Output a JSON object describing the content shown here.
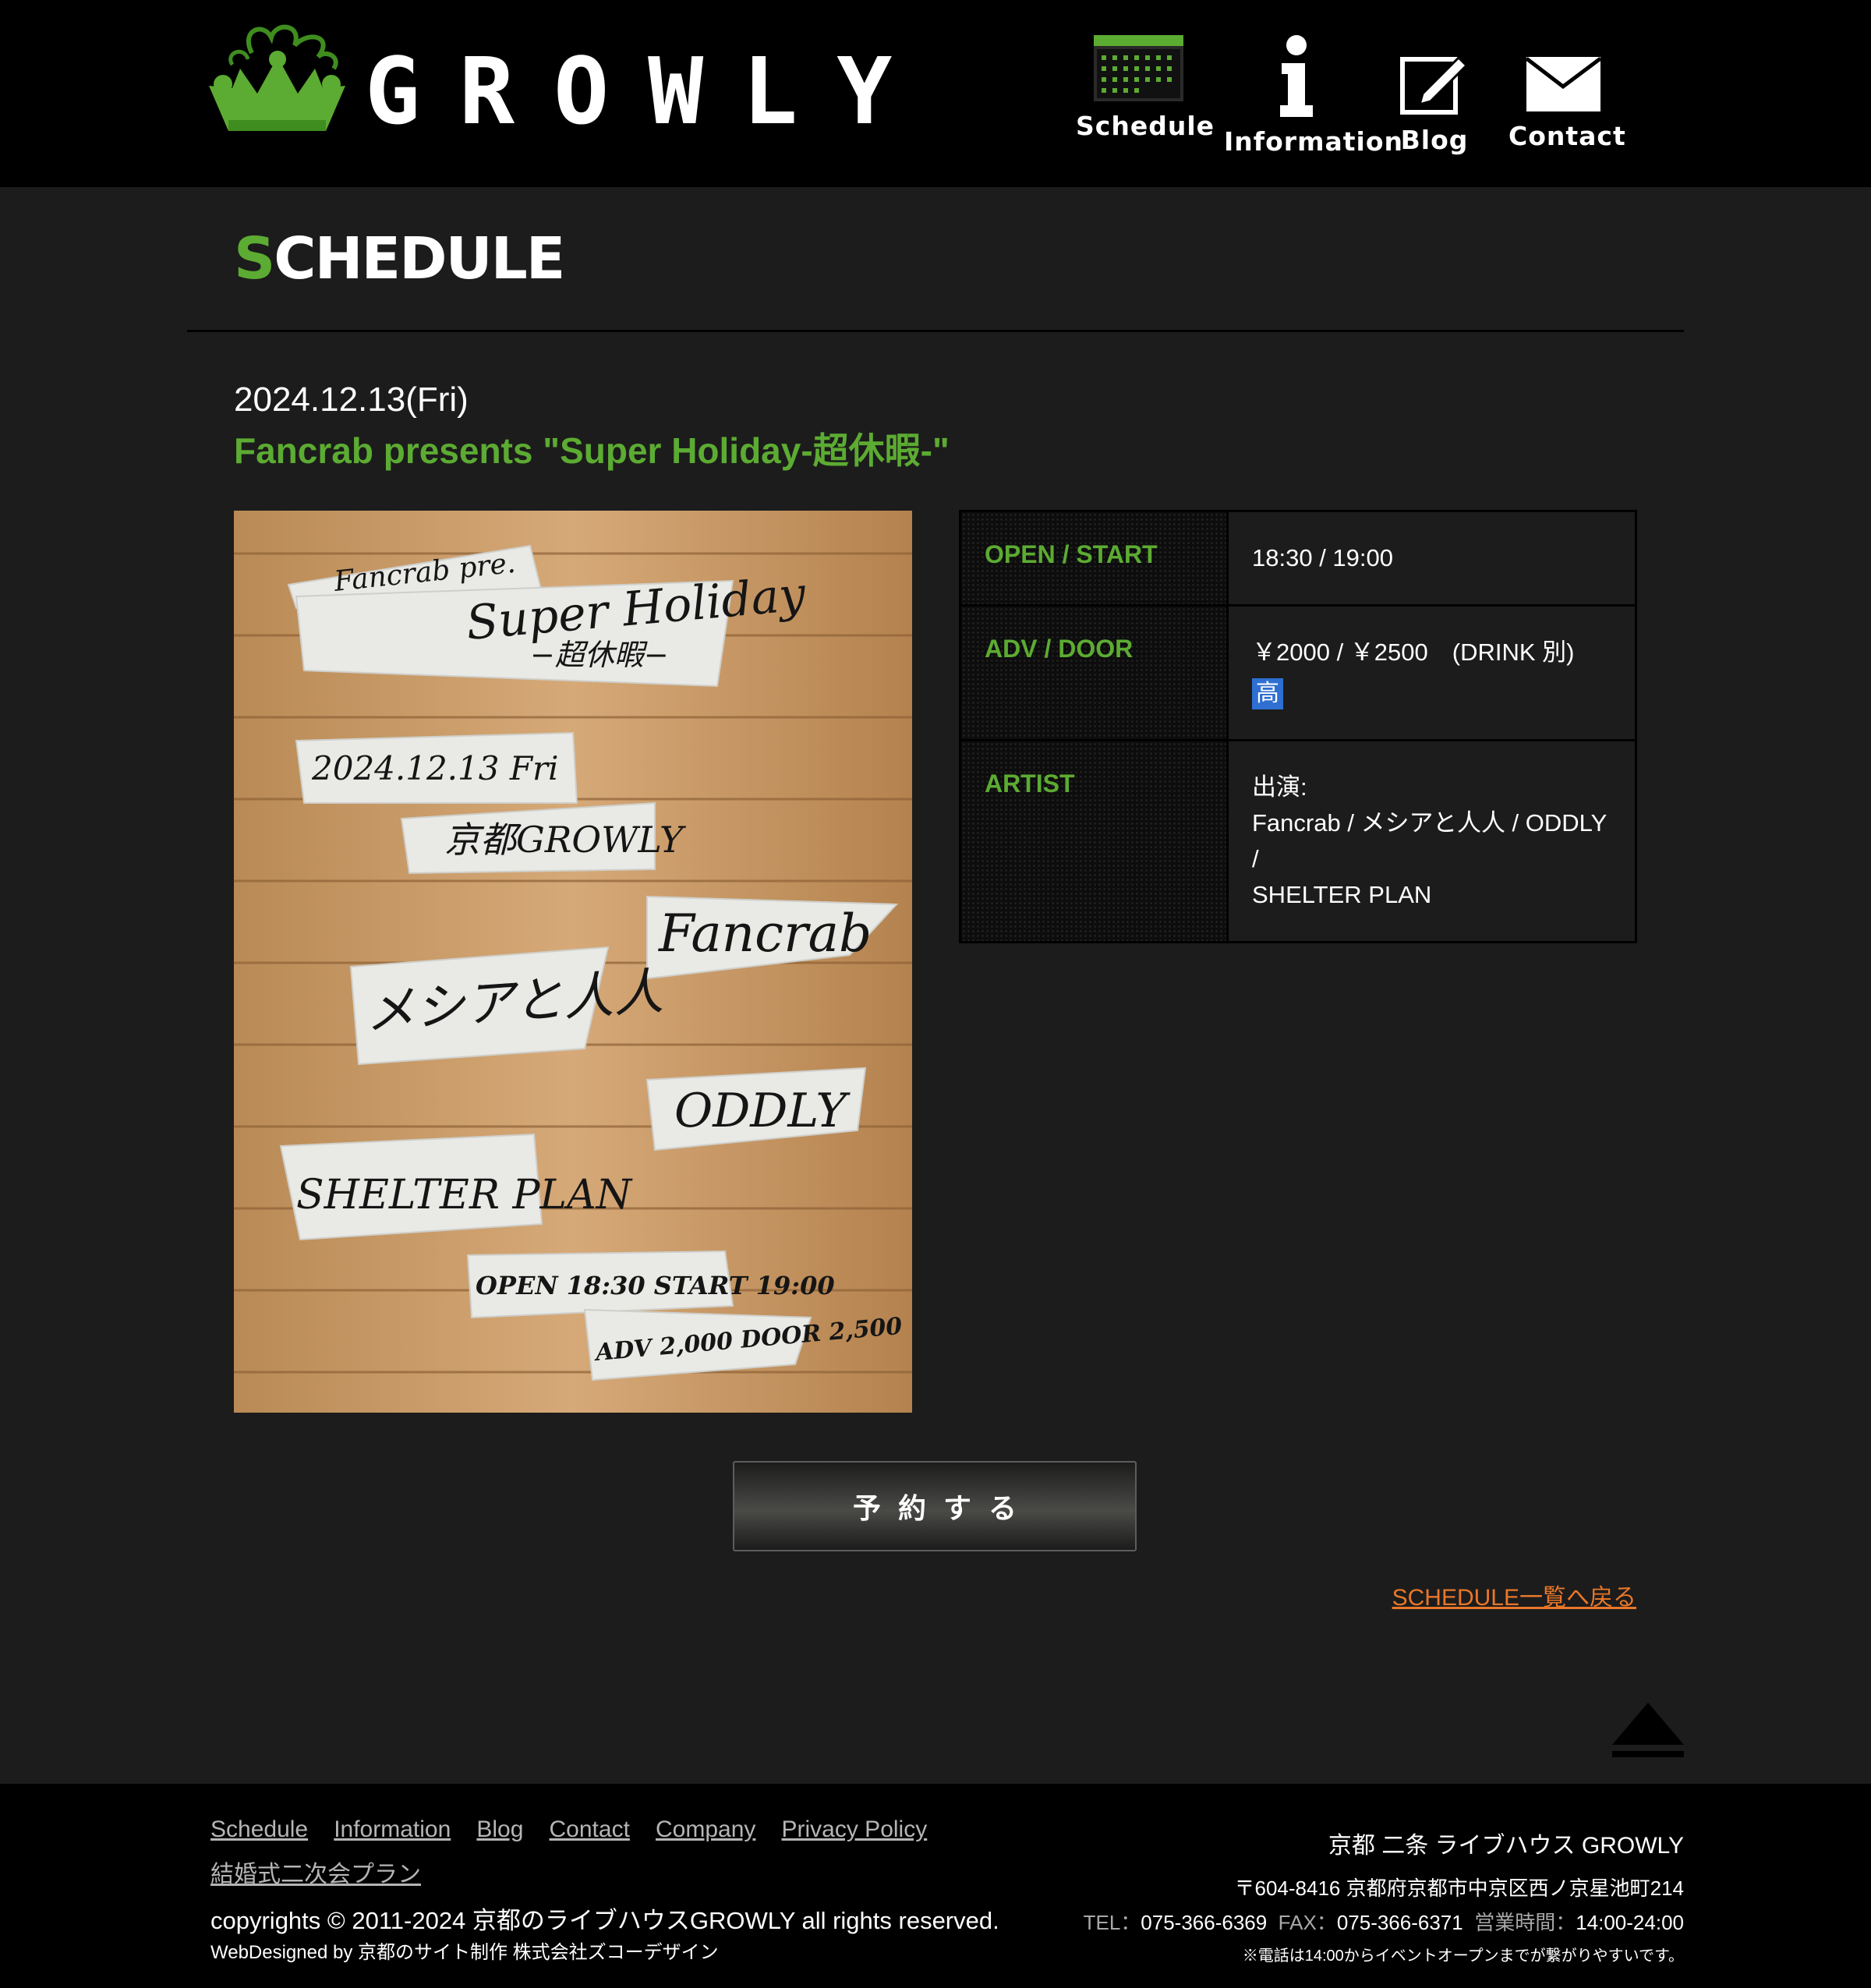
{
  "header": {
    "logo_text": "GROWLY",
    "nav": [
      {
        "label": "Schedule",
        "icon": "calendar-icon"
      },
      {
        "label": "Information",
        "icon": "info-icon"
      },
      {
        "label": "Blog",
        "icon": "pencil-note-icon"
      },
      {
        "label": "Contact",
        "icon": "envelope-icon"
      }
    ]
  },
  "main": {
    "page_title_first": "S",
    "page_title_rest": "CHEDULE",
    "event_date": "2024.12.13(Fri)",
    "event_title": "Fancrab presents \"Super Holiday-超休暇-\"",
    "flyer": {
      "texts": [
        "Fancrab pre.",
        "Super Holiday",
        "−超休暇−",
        "2024.12.13 Fri",
        "京都GROWLY",
        "Fancrab",
        "メシアと人人",
        "ODDLY",
        "SHELTER PLAN",
        "OPEN 18:30 START 19:00",
        "ADV 2,000 DOOR 2,500"
      ]
    },
    "info": {
      "open_label": "OPEN / START",
      "open_value": "18:30 / 19:00",
      "price_label": "ADV / DOOR",
      "price_value": "￥2000 / ￥2500　(DRINK 別)",
      "price_badge": "高",
      "artist_label": "ARTIST",
      "artist_heading": "出演:",
      "artist_line1": "Fancrab / メシアと人人 / ODDLY /",
      "artist_line2": "SHELTER PLAN"
    },
    "reserve_label": "予約する",
    "back_link": "SCHEDULE一覧へ戻る"
  },
  "footer": {
    "links": [
      "Schedule",
      "Information",
      "Blog",
      "Contact",
      "Company",
      "Privacy Policy",
      "結婚式二次会プラン"
    ],
    "copyright": "copyrights © 2011-2024 京都のライブハウスGROWLY all rights reserved.",
    "webdesign": "WebDesigned by 京都のサイト制作 株式会社ズコーデザイン",
    "venue_name": "京都 二条 ライブハウス GROWLY",
    "address": "〒604-8416 京都府京都市中京区西ノ京星池町214",
    "tel_label": "TEL：",
    "tel": "075-366-6369",
    "fax_label": "FAX：",
    "fax": "075-366-6371",
    "hours_label": "営業時間：",
    "hours": "14:00-24:00",
    "phone_note": "※電話は14:00からイベントオープンまでが繋がりやすいです。"
  },
  "colors": {
    "accent_green": "#5cab32",
    "link_orange": "#e8772a",
    "header_bg": "#000000",
    "page_bg": "#1c1c1c"
  }
}
